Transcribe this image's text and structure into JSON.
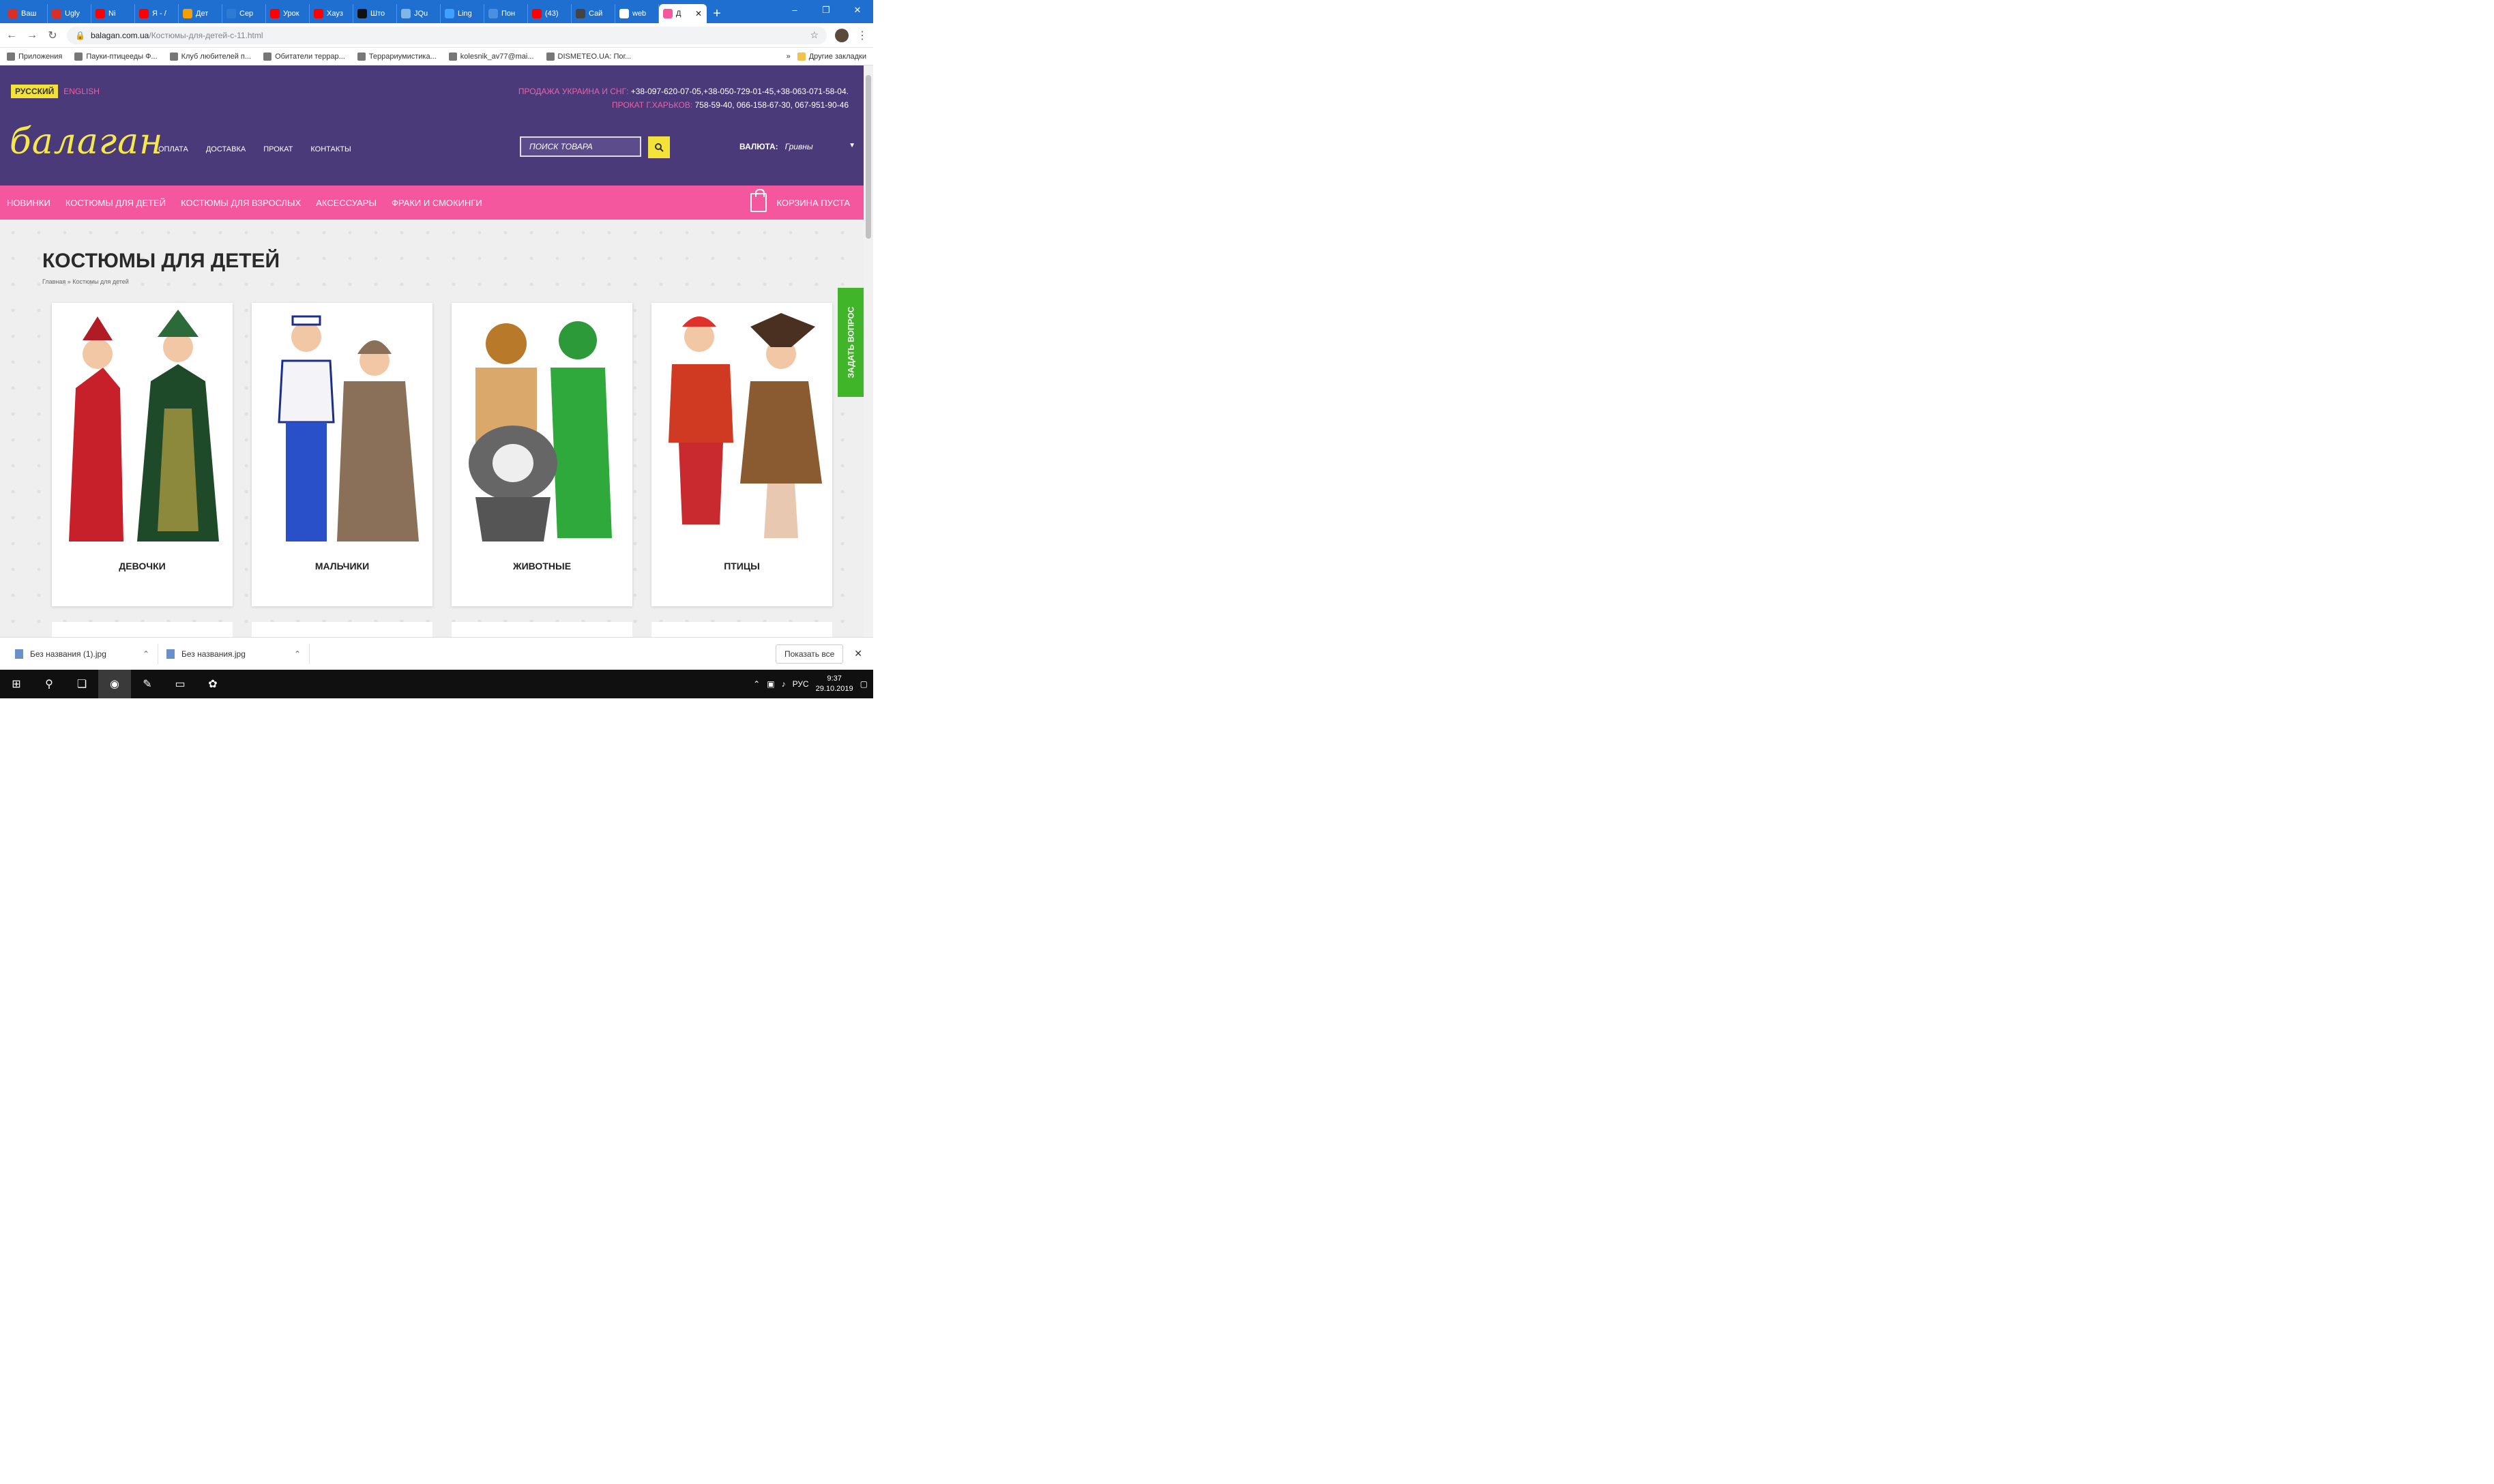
{
  "browser": {
    "tabs": [
      {
        "label": "Ваш",
        "color": "#d93025"
      },
      {
        "label": "Ugly",
        "color": "#d93025"
      },
      {
        "label": "Ni",
        "color": "#ff0000"
      },
      {
        "label": "Я - /",
        "color": "#ff0000"
      },
      {
        "label": "Дет",
        "color": "#f59f00"
      },
      {
        "label": "Сер",
        "color": "#2d7bd4"
      },
      {
        "label": "Урок",
        "color": "#ff0000"
      },
      {
        "label": "Хауз",
        "color": "#ff0000"
      },
      {
        "label": "Што",
        "color": "#111111"
      },
      {
        "label": "JQu",
        "color": "#7fb7e8"
      },
      {
        "label": "Ling",
        "color": "#40a0ff"
      },
      {
        "label": "Пон",
        "color": "#4a90e2"
      },
      {
        "label": "(43)",
        "color": "#ff0000"
      },
      {
        "label": "Сай",
        "color": "#444444"
      },
      {
        "label": "web",
        "color": "#ffffff"
      }
    ],
    "active_tab": {
      "label": "Д",
      "close": "✕"
    },
    "new_tab": "+",
    "window_controls": [
      "–",
      "❐",
      "✕"
    ],
    "url": {
      "domain": "balagan.com.ua",
      "path": "/Костюмы-для-детей-c-11.html"
    },
    "bookmarks": [
      "Приложения",
      "Пауки-птицееды Ф...",
      "Клуб любителей п...",
      "Обитатели террар...",
      "Террариумистика...",
      "kolesnik_av77@mai...",
      "DISMETEO.UA: Пог..."
    ],
    "bookmarks_more": "»",
    "other_bookmarks": "Другие закладки"
  },
  "site": {
    "lang_ru": "РУССКИЙ",
    "lang_en": "ENGLISH",
    "phone_line1_label": "ПРОДАЖА УКРАИНА И СНГ:",
    "phone_line1_numbers": "+38-097-620-07-05,+38-050-729-01-45,+38-063-071-58-04.",
    "phone_line2_label": "ПРОКАТ Г.ХАРЬКОВ:",
    "phone_line2_numbers": "758-59-40, 066-158-67-30, 067-951-90-46",
    "logo": "балаган",
    "topnav": [
      "ОПЛАТА",
      "ДОСТАВКА",
      "ПРОКАТ",
      "КОНТАКТЫ"
    ],
    "search_placeholder": "ПОИСК ТОВАРА",
    "currency_label": "ВАЛЮТА:",
    "currency_value": "Гривны",
    "categories": [
      "НОВИНКИ",
      "КОСТЮМЫ ДЛЯ ДЕТЕЙ",
      "КОСТЮМЫ ДЛЯ ВЗРОСЛЫХ",
      "АКСЕССУАРЫ",
      "ФРАКИ И СМОКИНГИ"
    ],
    "cart": "КОРЗИНА ПУСТА",
    "page_title": "КОСТЮМЫ ДЛЯ ДЕТЕЙ",
    "breadcrumb": "Главная » Костюмы для детей",
    "cards": [
      "ДЕВОЧКИ",
      "МАЛЬЧИКИ",
      "ЖИВОТНЫЕ",
      "ПТИЦЫ"
    ],
    "ask_button": "ЗАДАТЬ ВОПРОС",
    "colors": {
      "purple": "#4a3a7a",
      "pink": "#f4579d",
      "yellow": "#f3e23a",
      "green": "#41b52a"
    }
  },
  "downloads": {
    "items": [
      "Без названия (1).jpg",
      "Без названия.jpg"
    ],
    "show_all": "Показать все"
  },
  "taskbar": {
    "lang": "РУС",
    "time": "9:37",
    "date": "29.10.2019"
  }
}
